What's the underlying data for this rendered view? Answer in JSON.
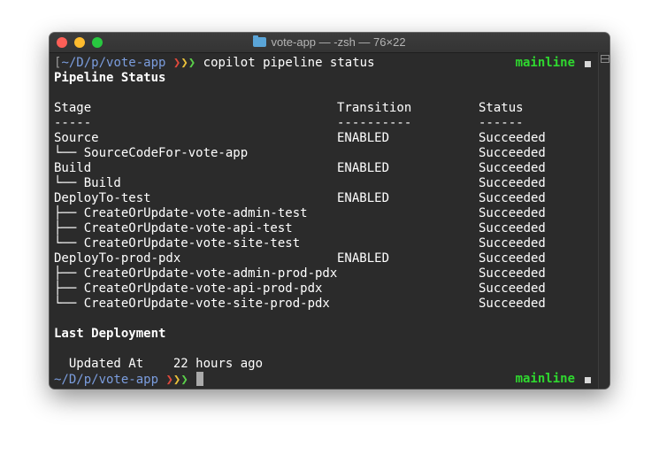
{
  "window": {
    "title": "vote-app — -zsh — 76×22",
    "title_icon": "folder-icon"
  },
  "prompt": {
    "cwd": "~/D/p/vote-app",
    "left_bracket": "[",
    "arrows": [
      "❯",
      "❯",
      "❯"
    ],
    "command": "copilot pipeline status",
    "branch": "mainline",
    "branch_mark": "■"
  },
  "pipeline": {
    "heading": "Pipeline Status",
    "headers": {
      "stage": "Stage",
      "transition": "Transition",
      "status": "Status"
    },
    "underlines": {
      "stage": "-----",
      "transition": "----------",
      "status": "------"
    },
    "rows": [
      {
        "stage": "Source",
        "transition": "ENABLED",
        "status": "Succeeded"
      },
      {
        "stage": "└── SourceCodeFor-vote-app",
        "transition": "",
        "status": "Succeeded"
      },
      {
        "stage": "Build",
        "transition": "ENABLED",
        "status": "Succeeded"
      },
      {
        "stage": "└── Build",
        "transition": "",
        "status": "Succeeded"
      },
      {
        "stage": "DeployTo-test",
        "transition": "ENABLED",
        "status": "Succeeded"
      },
      {
        "stage": "├── CreateOrUpdate-vote-admin-test",
        "transition": "",
        "status": "Succeeded"
      },
      {
        "stage": "├── CreateOrUpdate-vote-api-test",
        "transition": "",
        "status": "Succeeded"
      },
      {
        "stage": "└── CreateOrUpdate-vote-site-test",
        "transition": "",
        "status": "Succeeded"
      },
      {
        "stage": "DeployTo-prod-pdx",
        "transition": "ENABLED",
        "status": "Succeeded"
      },
      {
        "stage": "├── CreateOrUpdate-vote-admin-prod-pdx",
        "transition": "",
        "status": "Succeeded"
      },
      {
        "stage": "├── CreateOrUpdate-vote-api-prod-pdx",
        "transition": "",
        "status": "Succeeded"
      },
      {
        "stage": "└── CreateOrUpdate-vote-site-prod-pdx",
        "transition": "",
        "status": "Succeeded"
      }
    ]
  },
  "deployment": {
    "heading": "Last Deployment",
    "label": "Updated At",
    "value": "22 hours ago"
  }
}
